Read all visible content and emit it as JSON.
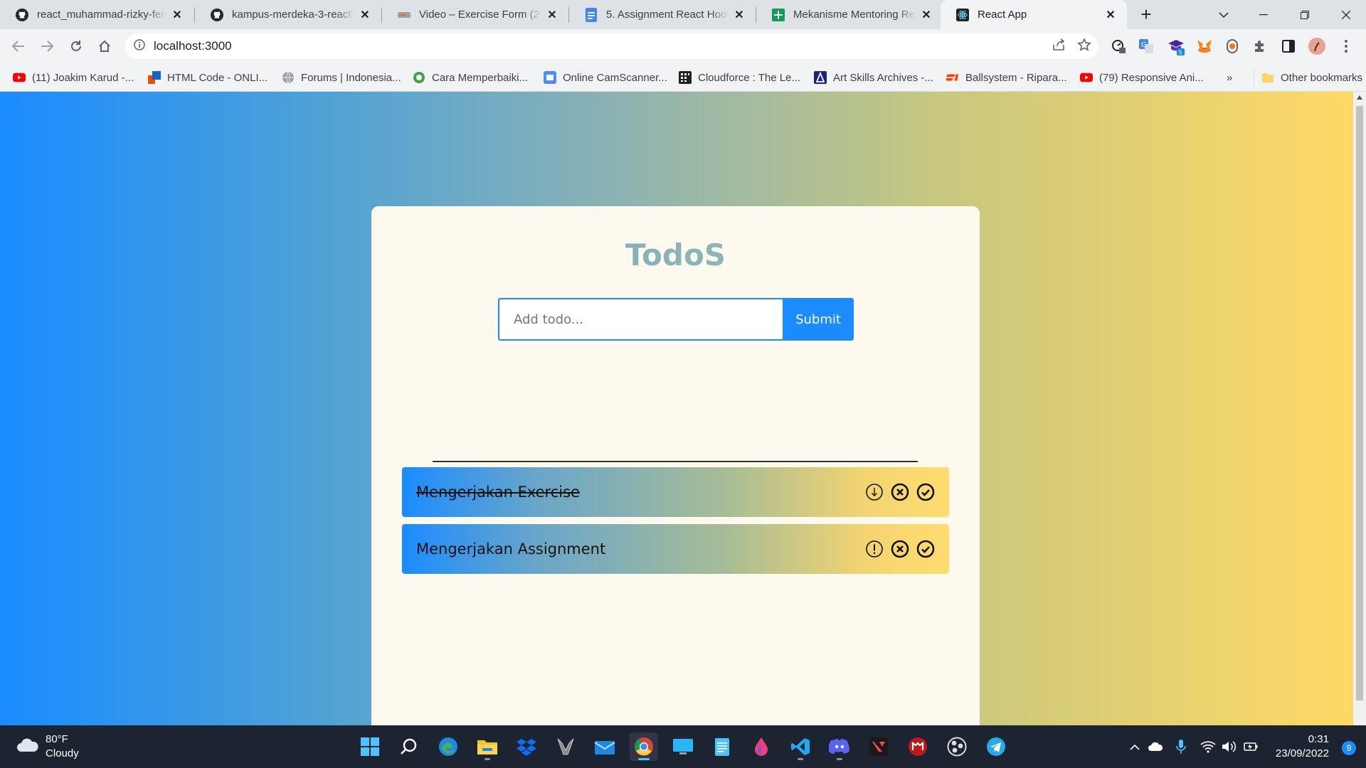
{
  "browser": {
    "tabs": [
      {
        "title": "react_muhammad-rizky-ferd",
        "icon": "github-icon"
      },
      {
        "title": "kampus-merdeka-3-react-B",
        "icon": "github-icon"
      },
      {
        "title": "Video – Exercise Form (20:3",
        "icon": "video-icon"
      },
      {
        "title": "5. Assignment React Hooks",
        "icon": "docs-icon"
      },
      {
        "title": "Mekanisme Mentoring Rea",
        "icon": "sheets-icon"
      },
      {
        "title": "React App",
        "icon": "react-icon",
        "active": true
      }
    ],
    "address": "localhost:3000",
    "bookmarks": [
      {
        "label": "(11) Joakim Karud -...",
        "icon": "youtube-icon"
      },
      {
        "label": "HTML Code - ONLI...",
        "icon": "html-icon"
      },
      {
        "label": "Forums | Indonesia...",
        "icon": "globe-icon"
      },
      {
        "label": "Cara Memperbaiki...",
        "icon": "green-circle-icon"
      },
      {
        "label": "Online CamScanner...",
        "icon": "camscanner-icon"
      },
      {
        "label": "Cloudforce : The Le...",
        "icon": "grid-icon"
      },
      {
        "label": "Art Skills Archives -...",
        "icon": "triangle-icon"
      },
      {
        "label": "Ballsystem - Ripara...",
        "icon": "ball-icon"
      },
      {
        "label": "(79) Responsive Ani...",
        "icon": "youtube-icon"
      }
    ],
    "bookmarks_more": "»",
    "other_bookmarks": "Other bookmarks"
  },
  "app": {
    "title": "TodoS",
    "input_placeholder": "Add todo...",
    "input_value": "",
    "submit_label": "Submit",
    "todos": [
      {
        "text": "Mengerjakan Exercise",
        "completed": true
      },
      {
        "text": "Mengerjakan Assignment",
        "completed": false
      }
    ]
  },
  "taskbar": {
    "weather_temp": "80°F",
    "weather_desc": "Cloudy",
    "time": "0:31",
    "date": "23/09/2022",
    "notifications": "9"
  },
  "colors": {
    "accent": "#1a8cff",
    "gradient_start": "#1a8cff",
    "gradient_end": "#ffd965",
    "card_bg": "#fdf9ef"
  }
}
